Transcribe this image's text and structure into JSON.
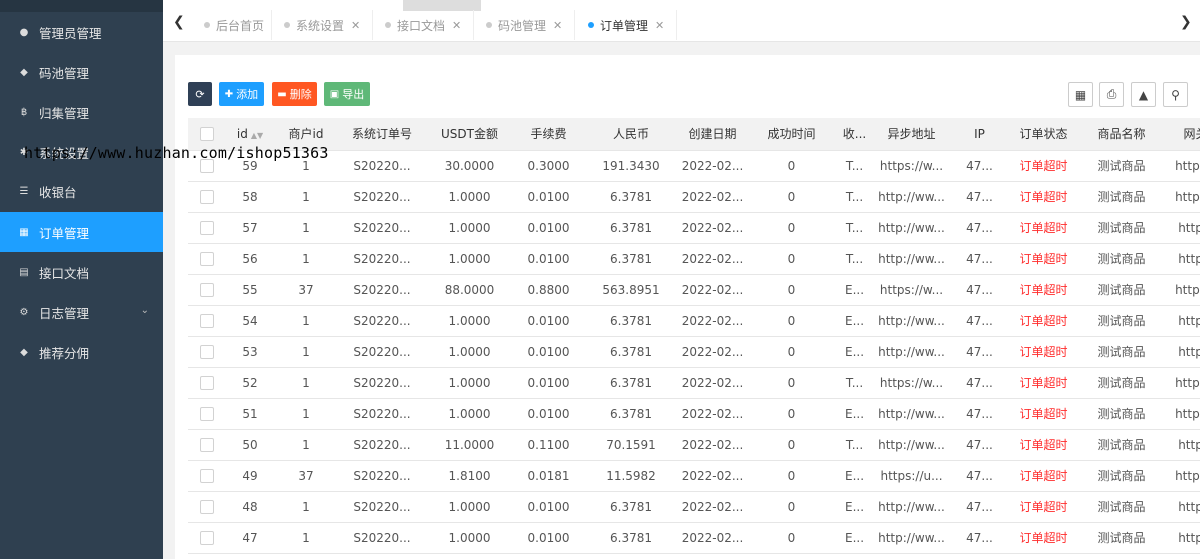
{
  "sidebar": {
    "items": [
      {
        "label": "管理员管理",
        "icon": "user-icon"
      },
      {
        "label": "码池管理",
        "icon": "android-icon"
      },
      {
        "label": "归集管理",
        "icon": "bitcoin-icon"
      },
      {
        "label": "系统设置",
        "icon": "gear-icon"
      },
      {
        "label": "收银台",
        "icon": "list-icon"
      },
      {
        "label": "订单管理",
        "icon": "calculator-icon",
        "active": true
      },
      {
        "label": "接口文档",
        "icon": "document-icon"
      },
      {
        "label": "日志管理",
        "icon": "cog-icon",
        "has_arrow": true
      },
      {
        "label": "推荐分佣",
        "icon": "android-icon"
      }
    ]
  },
  "watermark": "https://www.huzhan.com/ishop51363",
  "tabs": [
    {
      "label": "后台首页",
      "closable": false
    },
    {
      "label": "系统设置",
      "closable": true
    },
    {
      "label": "接口文档",
      "closable": true
    },
    {
      "label": "码池管理",
      "closable": true
    },
    {
      "label": "订单管理",
      "closable": true,
      "active": true
    }
  ],
  "toolbar": {
    "add_label": "添加",
    "delete_label": "删除",
    "export_label": "导出",
    "colors": {
      "refresh": "#2f4056",
      "add": "#1e9fff",
      "delete": "#ff5722",
      "export": "#5fb878"
    }
  },
  "table": {
    "columns": [
      "id",
      "商户id",
      "系统订单号",
      "USDT金额",
      "手续费",
      "人民币",
      "创建日期",
      "成功时间",
      "收...",
      "异步地址",
      "IP",
      "订单状态",
      "商品名称",
      "网关地"
    ],
    "rows": [
      [
        "59",
        "1",
        "S20220...",
        "30.0000",
        "0.3000",
        "191.3430",
        "2022-02...",
        "0",
        "T...",
        "https://w...",
        "47...",
        "订单超时",
        "测试商品",
        "https://w"
      ],
      [
        "58",
        "1",
        "S20220...",
        "1.0000",
        "0.0100",
        "6.3781",
        "2022-02...",
        "0",
        "T...",
        "http://ww...",
        "47...",
        "订单超时",
        "测试商品",
        "https://w"
      ],
      [
        "57",
        "1",
        "S20220...",
        "1.0000",
        "0.0100",
        "6.3781",
        "2022-02...",
        "0",
        "T...",
        "http://ww...",
        "47...",
        "订单超时",
        "测试商品",
        "http://w"
      ],
      [
        "56",
        "1",
        "S20220...",
        "1.0000",
        "0.0100",
        "6.3781",
        "2022-02...",
        "0",
        "T...",
        "http://ww...",
        "47...",
        "订单超时",
        "测试商品",
        "http://w"
      ],
      [
        "55",
        "37",
        "S20220...",
        "88.0000",
        "0.8800",
        "563.8951",
        "2022-02...",
        "0",
        "E...",
        "https://w...",
        "47...",
        "订单超时",
        "测试商品",
        "https://w"
      ],
      [
        "54",
        "1",
        "S20220...",
        "1.0000",
        "0.0100",
        "6.3781",
        "2022-02...",
        "0",
        "E...",
        "http://ww...",
        "47...",
        "订单超时",
        "测试商品",
        "http://w"
      ],
      [
        "53",
        "1",
        "S20220...",
        "1.0000",
        "0.0100",
        "6.3781",
        "2022-02...",
        "0",
        "E...",
        "http://ww...",
        "47...",
        "订单超时",
        "测试商品",
        "http://w"
      ],
      [
        "52",
        "1",
        "S20220...",
        "1.0000",
        "0.0100",
        "6.3781",
        "2022-02...",
        "0",
        "T...",
        "https://w...",
        "47...",
        "订单超时",
        "测试商品",
        "https://w"
      ],
      [
        "51",
        "1",
        "S20220...",
        "1.0000",
        "0.0100",
        "6.3781",
        "2022-02...",
        "0",
        "E...",
        "http://ww...",
        "47...",
        "订单超时",
        "测试商品",
        "https://w"
      ],
      [
        "50",
        "1",
        "S20220...",
        "11.0000",
        "0.1100",
        "70.1591",
        "2022-02...",
        "0",
        "T...",
        "http://ww...",
        "47...",
        "订单超时",
        "测试商品",
        "http://w"
      ],
      [
        "49",
        "37",
        "S20220...",
        "1.8100",
        "0.0181",
        "11.5982",
        "2022-02...",
        "0",
        "E...",
        "https://u...",
        "47...",
        "订单超时",
        "测试商品",
        "https://w"
      ],
      [
        "48",
        "1",
        "S20220...",
        "1.0000",
        "0.0100",
        "6.3781",
        "2022-02...",
        "0",
        "E...",
        "http://ww...",
        "47...",
        "订单超时",
        "测试商品",
        "http://w"
      ],
      [
        "47",
        "1",
        "S20220...",
        "1.0000",
        "0.0100",
        "6.3781",
        "2022-02...",
        "0",
        "E...",
        "http://ww...",
        "47...",
        "订单超时",
        "测试商品",
        "http://w"
      ]
    ]
  }
}
